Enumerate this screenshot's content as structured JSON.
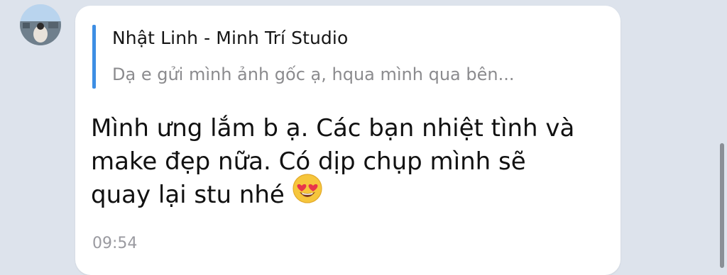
{
  "reply": {
    "sender": "Nhật Linh - Minh Trí Studio",
    "preview": "Dạ e gửi mình ảnh gốc ạ, hqua mình qua bên..."
  },
  "message": {
    "lines": [
      "Mình ưng lắm b ạ. Các bạn nhiệt tình và",
      "make đẹp nữa. Có dịp chụp mình sẽ",
      "quay lại stu nhé"
    ],
    "emoji": "heart-eyes-emoji",
    "time": "09:54"
  },
  "colors": {
    "background": "#dde3ec",
    "bubble": "#ffffff",
    "reply_bar": "#3d8ee4",
    "time_text": "#9a9aa0"
  }
}
